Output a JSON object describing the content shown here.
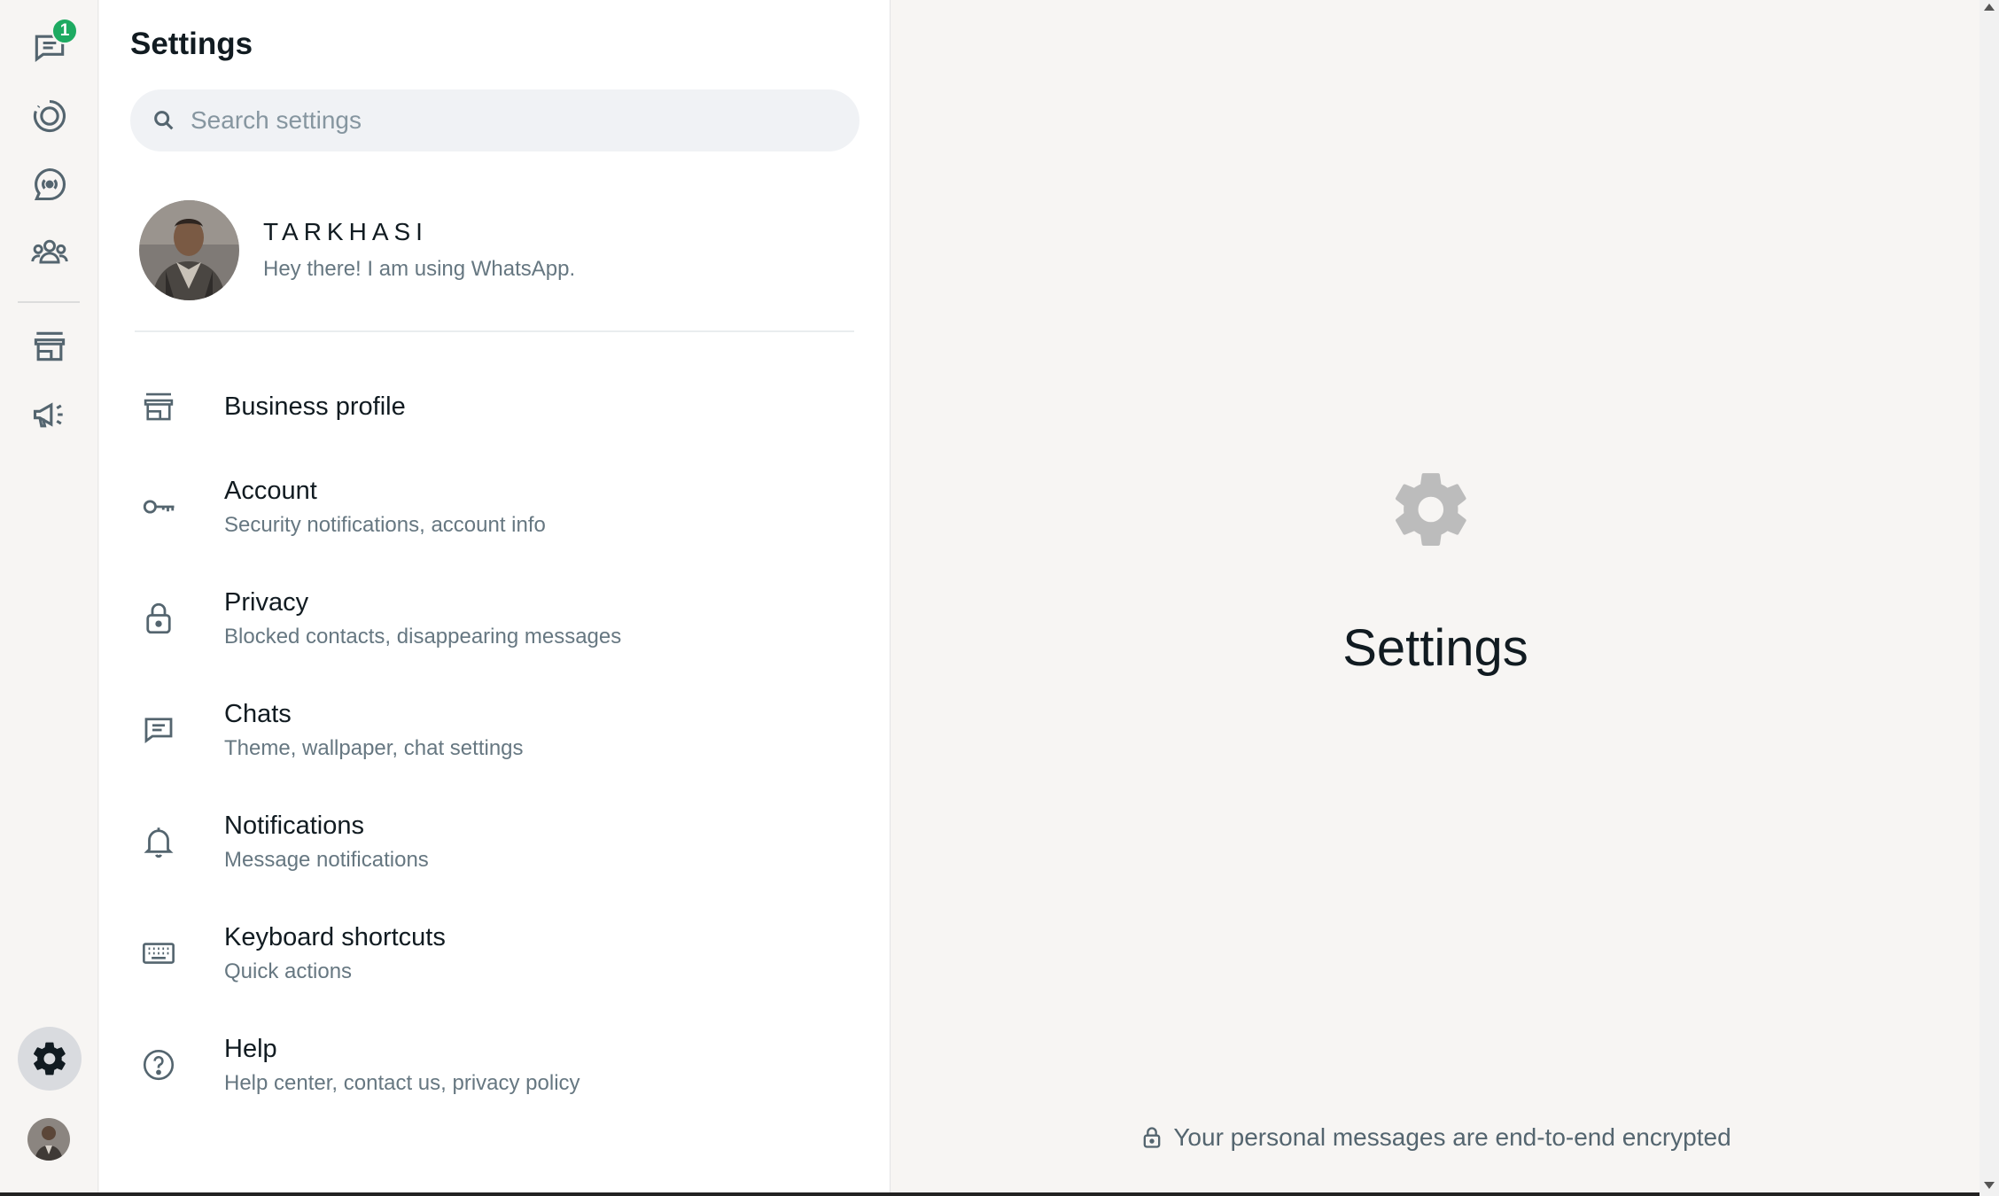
{
  "rail": {
    "chats_badge": "1",
    "items": [
      {
        "name": "chats"
      },
      {
        "name": "status"
      },
      {
        "name": "channels"
      },
      {
        "name": "communities"
      },
      {
        "name": "tools"
      },
      {
        "name": "advertise"
      }
    ]
  },
  "panel": {
    "title": "Settings",
    "search_placeholder": "Search settings",
    "profile": {
      "name": "TARKHASI",
      "status": "Hey there! I am using WhatsApp."
    },
    "menu": [
      {
        "label": "Business profile",
        "sub": "",
        "icon": "store-icon"
      },
      {
        "label": "Account",
        "sub": "Security notifications, account info",
        "icon": "key-icon"
      },
      {
        "label": "Privacy",
        "sub": "Blocked contacts, disappearing messages",
        "icon": "lock-icon"
      },
      {
        "label": "Chats",
        "sub": "Theme, wallpaper, chat settings",
        "icon": "chat-icon"
      },
      {
        "label": "Notifications",
        "sub": "Message notifications",
        "icon": "bell-icon"
      },
      {
        "label": "Keyboard shortcuts",
        "sub": "Quick actions",
        "icon": "keyboard-icon"
      },
      {
        "label": "Help",
        "sub": "Help center, contact us, privacy policy",
        "icon": "help-icon"
      }
    ]
  },
  "main": {
    "title": "Settings",
    "footer": "Your personal messages are end-to-end encrypted"
  },
  "colors": {
    "accent_green": "#1daa61",
    "icon_gray": "#54656f",
    "secondary_text": "#667781"
  }
}
